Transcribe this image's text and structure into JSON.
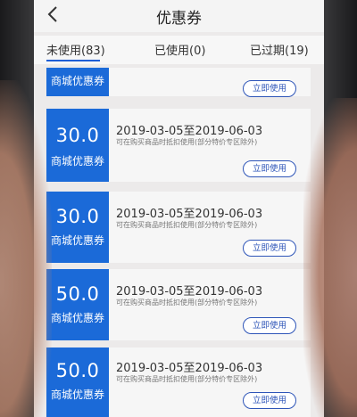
{
  "header": {
    "title": "优惠券"
  },
  "tabs": [
    {
      "label": "未使用(83)"
    },
    {
      "label": "已使用(0)"
    },
    {
      "label": "已过期(19)"
    }
  ],
  "coupons": [
    {
      "amount": "",
      "label": "商城优惠券",
      "dates": "",
      "desc": "",
      "button": "立即使用"
    },
    {
      "amount": "30.0",
      "label": "商城优惠券",
      "dates": "2019-03-05至2019-06-03",
      "desc": "可在购买商品时抵扣使用(部分特价专区除外)",
      "button": "立即使用"
    },
    {
      "amount": "30.0",
      "label": "商城优惠券",
      "dates": "2019-03-05至2019-06-03",
      "desc": "可在购买商品时抵扣使用(部分特价专区除外)",
      "button": "立即使用"
    },
    {
      "amount": "50.0",
      "label": "商城优惠券",
      "dates": "2019-03-05至2019-06-03",
      "desc": "可在购买商品时抵扣使用(部分特价专区除外)",
      "button": "立即使用"
    },
    {
      "amount": "50.0",
      "label": "商城优惠券",
      "dates": "2019-03-05至2019-06-03",
      "desc": "可在购买商品时抵扣使用(部分特价专区除外)",
      "button": "立即使用"
    }
  ],
  "colors": {
    "accent": "#1b6ad8",
    "button_border": "#2e55b8",
    "background": "#eceaea"
  }
}
